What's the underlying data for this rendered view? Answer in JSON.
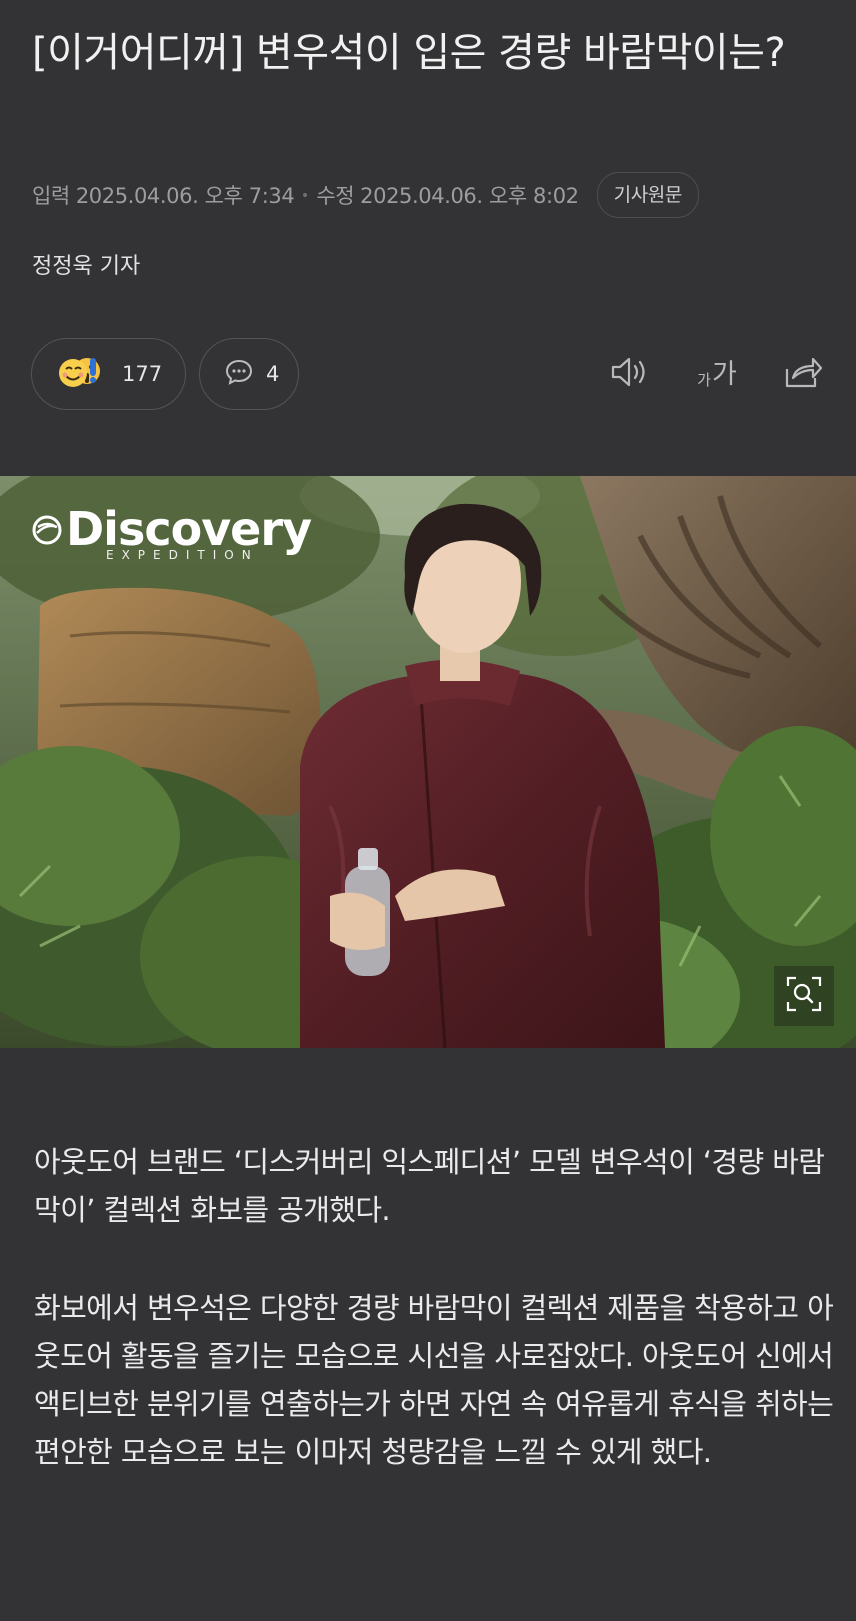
{
  "article": {
    "title": "[이거어디꺼] 변우석이 입은 경량 바람막이는?",
    "meta": {
      "input_label": "입력",
      "input_time": "2025.04.06. 오후 7:34",
      "edit_label": "수정",
      "edit_time": "2025.04.06. 오후 8:02",
      "original_button": "기사원문"
    },
    "reporter": "정정욱 기자",
    "reactions": {
      "count": "177",
      "icon": "smile-and-wow-emoji-icon"
    },
    "comments": {
      "count": "4",
      "icon": "speech-bubble-icon"
    },
    "tools": [
      "speaker-icon",
      "font-size-icon",
      "share-icon"
    ],
    "font_tool": {
      "small": "가",
      "big": "가"
    }
  },
  "photo": {
    "brand_name": "Discovery",
    "brand_sub": "EXPEDITION",
    "zoom_icon": "magnify-expand-icon"
  },
  "body": {
    "paragraph1": "아웃도어 브랜드 ‘디스커버리 익스페디션’ 모델 변우석이 ‘경량 바람막이’ 컬렉션 화보를 공개했다.",
    "paragraph2": "화보에서 변우석은 다양한 경량 바람막이 컬렉션 제품을 착용하고 아웃도어 활동을 즐기는 모습으로 시선을 사로잡았다. 아웃도어 신에서 액티브한 분위기를 연출하는가 하면 자연 속 여유롭게 휴식을 취하는 편안한 모습으로 보는 이마저 청량감을 느낄 수 있게 했다."
  },
  "colors": {
    "background": "#333335",
    "text": "#ececec",
    "meta_text": "#9d9d9f",
    "jacket": "#5a2226"
  }
}
